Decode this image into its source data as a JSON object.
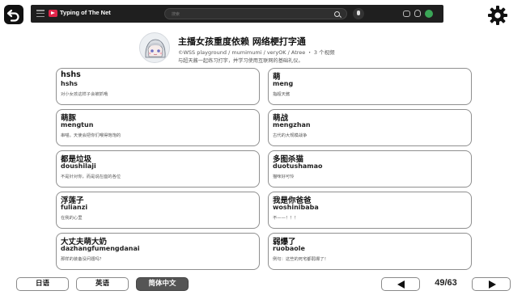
{
  "topbar": {
    "site_title": "Typing of The Net",
    "search_placeholder": "搜索"
  },
  "channel": {
    "title": "主播女孩重度依赖 网络梗打字通",
    "meta": "©WSS playground / mumimumi / veryOK / Atree ・ 3 个视频",
    "description": "与超天酱一起练习打字，并学习使用互联网的基础礼仪。"
  },
  "cards": [
    {
      "word": "hshs",
      "pinyin": "hshs",
      "desc": "对小女孩这样子会被抓哦"
    },
    {
      "word": "萌",
      "pinyin": "meng",
      "desc": "指超天酱"
    },
    {
      "word": "萌豚",
      "pinyin": "mengtun",
      "desc": "串喵。天使会把你们喂得饱饱的"
    },
    {
      "word": "萌战",
      "pinyin": "mengzhan",
      "desc": "古代的大规模战争"
    },
    {
      "word": "都是垃圾",
      "pinyin": "doushilaji",
      "desc": "不是针对你，而是说在座的各位"
    },
    {
      "word": "多图杀猫",
      "pinyin": "duotushamao",
      "desc": "猫咪好可怜"
    },
    {
      "word": "浮莲子",
      "pinyin": "fulianzi",
      "desc": "在我的心里"
    },
    {
      "word": "我是你爸爸",
      "pinyin": "woshinibaba",
      "desc": "不——！！！"
    },
    {
      "word": "大丈夫萌大奶",
      "pinyin": "dazhangfumengdanai",
      "desc": "那样的装备没问题吗？"
    },
    {
      "word": "弱爆了",
      "pinyin": "ruobaole",
      "desc": "例句：这些的死宅都弱爆了！"
    }
  ],
  "languages": [
    {
      "label": "日语",
      "active": false
    },
    {
      "label": "英语",
      "active": false
    },
    {
      "label": "简体中文",
      "active": true
    }
  ],
  "pagination": {
    "current": "49/63",
    "prev_icon": "triangle-left-icon",
    "next_icon": "triangle-right-icon"
  },
  "colors": {
    "accent": "#e0254a",
    "active_tab": "#555555",
    "card_border": "#8f8f8f"
  }
}
